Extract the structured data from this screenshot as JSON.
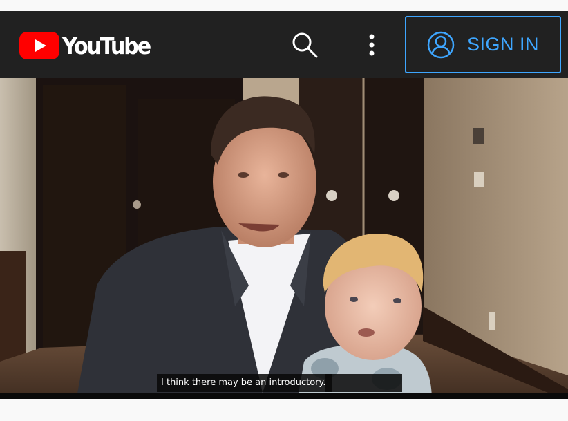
{
  "header": {
    "logo_text": "YouTube",
    "search_icon": "search-icon",
    "more_icon": "more-vert-icon",
    "signin_label": "SIGN IN",
    "signin_icon": "account-circle-icon"
  },
  "player": {
    "caption": "I think there may be an introductory."
  },
  "colors": {
    "header_bg": "#212121",
    "brand_red": "#ff0000",
    "signin_blue": "#3ea6ff",
    "page_bg": "#f9f9f9"
  }
}
